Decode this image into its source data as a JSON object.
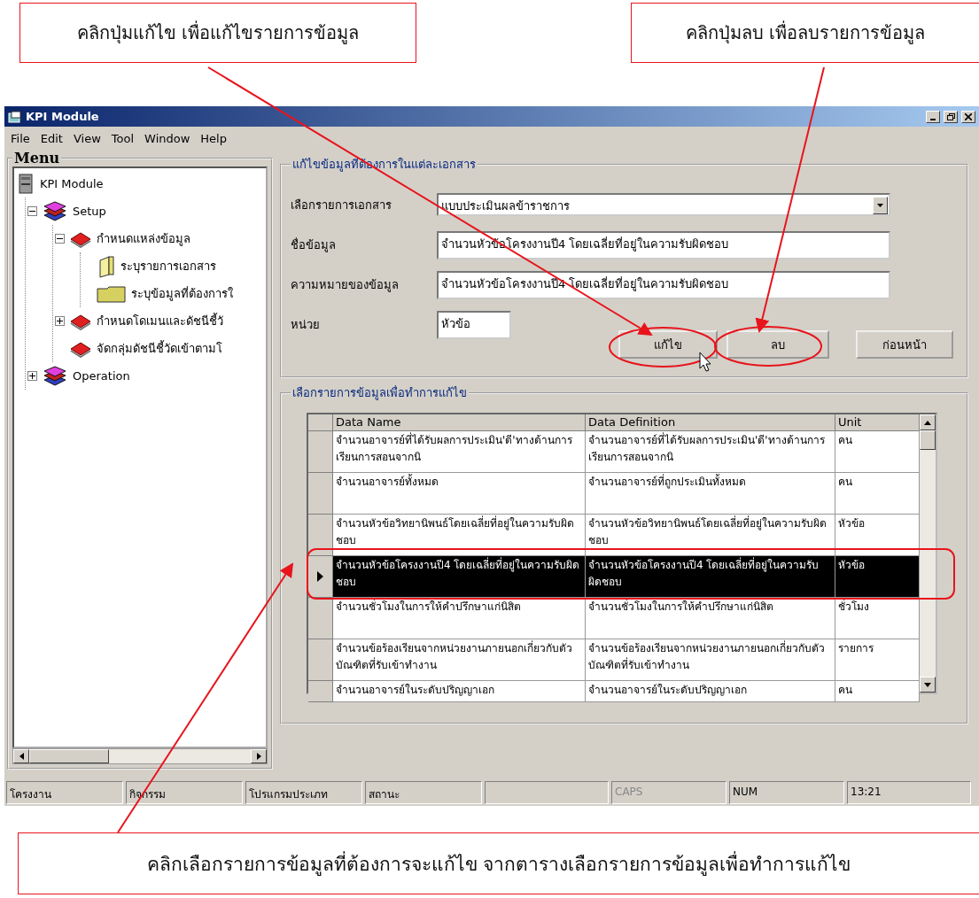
{
  "callouts": [
    {
      "text": "คลิกปุ่มแก้ไข เพื่อแก้ไขรายการข้อมูล"
    },
    {
      "text": "คลิกปุ่มลบ เพื่อลบรายการข้อมูล"
    },
    {
      "text": "คลิกเลือกรายการข้อมูลที่ต้องการจะแก้ไข จากตารางเลือกรายการข้อมูลเพื่อทำการแก้ไข"
    }
  ],
  "window": {
    "title": "KPI Module"
  },
  "menu": [
    "File",
    "Edit",
    "View",
    "Tool",
    "Window",
    "Help"
  ],
  "sidebar": {
    "title": "Menu",
    "tree": [
      {
        "label": "KPI Module",
        "kind": "computer",
        "children": [
          {
            "label": "Setup",
            "kind": "books",
            "expanded": true,
            "children": [
              {
                "label": "กำหนดแหล่งข้อมูล",
                "kind": "book",
                "expanded": true,
                "children": [
                  {
                    "label": "ระบุรายการเอกสาร",
                    "kind": "binder"
                  },
                  {
                    "label": "ระบุข้อมูลที่ต้องการใ",
                    "kind": "folder"
                  }
                ]
              },
              {
                "label": "กำหนดโดเมนและดัชนีชี้วั",
                "kind": "book",
                "expanded": false
              },
              {
                "label": "จัดกลุ่มดัชนีชี้วัดเข้าตามโ",
                "kind": "book"
              }
            ]
          },
          {
            "label": "Operation",
            "kind": "books",
            "expanded": false
          }
        ]
      }
    ]
  },
  "edit_form": {
    "title": "แก้ไขข้อมูลที่ต้องการในแต่ละเอกสาร",
    "fields": [
      {
        "label": "เลือกรายการเอกสาร",
        "value": "แบบประเมินผลข้าราชการ",
        "kind": "dropdown"
      },
      {
        "label": "ชื่อข้อมูล",
        "value": "จำนวนหัวข้อโครงงานปี4 โดยเฉลี่ยที่อยู่ในความรับผิดชอบ",
        "kind": "text"
      },
      {
        "label": "ความหมายของข้อมูล",
        "value": "จำนวนหัวข้อโครงงานปี4 โดยเฉลี่ยที่อยู่ในความรับผิดชอบ",
        "kind": "text"
      },
      {
        "label": "หน่วย",
        "value": "หัวข้อ",
        "kind": "short"
      }
    ],
    "buttons": [
      "แก้ไข",
      "ลบ",
      "ก่อนหน้า"
    ]
  },
  "table": {
    "title": "เลือกรายการข้อมูลเพื่อทำการแก้ไข",
    "columns": [
      "Data Name",
      "Data Definition",
      "Unit"
    ],
    "rows": [
      {
        "cells": [
          "จำนวนอาจารย์ที่ได้รับผลการประเมิน'ดี'ทางด้านการเรียนการสอนจากนิ",
          "จำนวนอาจารย์ที่ได้รับผลการประเมิน'ดี'ทางด้านการเรียนการสอนจากนิ",
          "คน"
        ],
        "selected": false
      },
      {
        "cells": [
          "จำนวนอาจารย์ทั้งหมด",
          "จำนวนอาจารย์ที่ถูกประเมินทั้งหมด",
          "คน"
        ],
        "selected": false
      },
      {
        "cells": [
          "จำนวนหัวข้อวิทยานิพนธ์โดยเฉลี่ยที่อยู่ในความรับผิดชอบ",
          "จำนวนหัวข้อวิทยานิพนธ์โดยเฉลี่ยที่อยู่ในความรับผิดชอบ",
          "หัวข้อ"
        ],
        "selected": false
      },
      {
        "cells": [
          "จำนวนหัวข้อโครงงานปี4 โดยเฉลี่ยที่อยู่ในความรับผิดชอบ",
          "จำนวนหัวข้อโครงงานปี4 โดยเฉลี่ยที่อยู่ในความรับผิดชอบ",
          "หัวข้อ"
        ],
        "selected": true
      },
      {
        "cells": [
          "จำนวนชั่วโมงในการให้คำปรึกษาแก่นิสิต",
          "จำนวนชั่วโมงในการให้คำปรึกษาแก่นิสิต",
          "ชั่วโมง"
        ],
        "selected": false
      },
      {
        "cells": [
          "จำนวนข้อร้องเรียนจากหน่วยงานภายนอกเกี่ยวกับตัวบัณฑิตที่รับเข้าทำงาน",
          "จำนวนข้อร้องเรียนจากหน่วยงานภายนอกเกี่ยวกับตัวบัณฑิตที่รับเข้าทำงาน",
          "รายการ"
        ],
        "selected": false
      },
      {
        "cells": [
          "จำนวนอาจารย์ในระดับปริญญาเอก",
          "จำนวนอาจารย์ในระดับปริญญาเอก",
          "คน"
        ],
        "selected": false
      }
    ]
  },
  "status_bar": [
    {
      "text": "โครงงาน",
      "disabled": false
    },
    {
      "text": "กิจกรรม",
      "disabled": false
    },
    {
      "text": "โปรแกรมประเภท",
      "disabled": false
    },
    {
      "text": "สถานะ",
      "disabled": false
    },
    {
      "text": "CAPS",
      "disabled": true
    },
    {
      "text": "NUM",
      "disabled": false
    },
    {
      "text": "13:21",
      "disabled": false
    }
  ]
}
